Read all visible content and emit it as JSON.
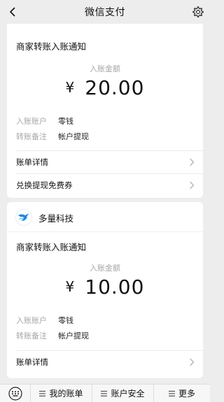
{
  "header": {
    "title": "微信支付",
    "back_icon": "chevron-left-icon",
    "settings_icon": "gear-icon"
  },
  "notifications": [
    {
      "title": "商家转账入账通知",
      "amount_label": "入账金额",
      "currency": "¥",
      "amount": "20.00",
      "fields": [
        {
          "key": "入账账户",
          "value": "零钱"
        },
        {
          "key": "转账备注",
          "value": "帐户提现"
        }
      ],
      "links": [
        "账单详情",
        "兑换提现免费券"
      ]
    },
    {
      "brand": {
        "name": "多量科技",
        "logo_icon": "bird-logo-icon"
      },
      "title": "商家转账入账通知",
      "amount_label": "入账金额",
      "currency": "¥",
      "amount": "10.00",
      "fields": [
        {
          "key": "入账账户",
          "value": "零钱"
        },
        {
          "key": "转账备注",
          "value": "帐户提现"
        }
      ],
      "links": [
        "账单详情"
      ]
    }
  ],
  "bottom_menu": {
    "keyboard_icon": "keyboard-icon",
    "items": [
      "我的账单",
      "账户安全",
      "更多"
    ]
  },
  "colors": {
    "background": "#ededed",
    "card": "#ffffff",
    "secondary_text": "#a6a6a6",
    "brand_blue": "#1e88e5"
  }
}
